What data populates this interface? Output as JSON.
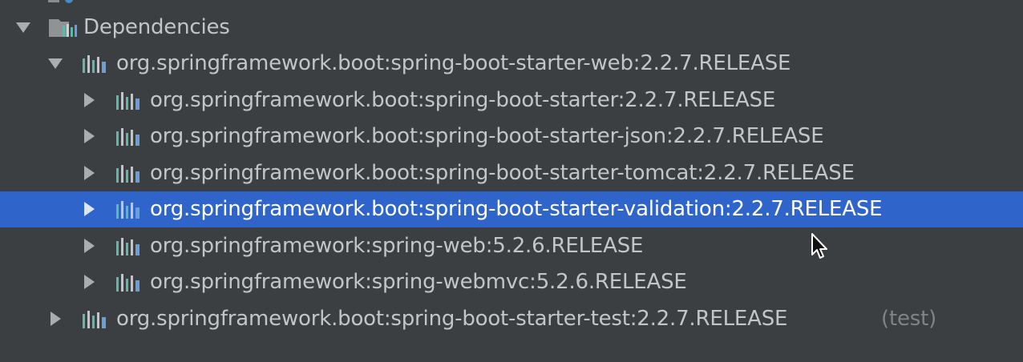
{
  "tree": {
    "root": {
      "label": "Dependencies",
      "icon": "library-folder-icon",
      "expanded": true
    },
    "items": [
      {
        "label": "org.springframework.boot:spring-boot-starter-web:2.2.7.RELEASE",
        "suffix": "",
        "expanded": true,
        "selected": false
      },
      {
        "label": "org.springframework.boot:spring-boot-starter:2.2.7.RELEASE",
        "suffix": "",
        "expanded": false,
        "selected": false
      },
      {
        "label": "org.springframework.boot:spring-boot-starter-json:2.2.7.RELEASE",
        "suffix": "",
        "expanded": false,
        "selected": false
      },
      {
        "label": "org.springframework.boot:spring-boot-starter-tomcat:2.2.7.RELEASE",
        "suffix": "",
        "expanded": false,
        "selected": false
      },
      {
        "label": "org.springframework.boot:spring-boot-starter-validation:2.2.7.RELEASE",
        "suffix": "",
        "expanded": false,
        "selected": true
      },
      {
        "label": "org.springframework:spring-web:5.2.6.RELEASE",
        "suffix": "",
        "expanded": false,
        "selected": false
      },
      {
        "label": "org.springframework:spring-webmvc:5.2.6.RELEASE",
        "suffix": "",
        "expanded": false,
        "selected": false
      },
      {
        "label": "org.springframework.boot:spring-boot-starter-test:2.2.7.RELEASE",
        "suffix": "(test)",
        "expanded": false,
        "selected": false
      }
    ]
  },
  "colors": {
    "background": "#3c3f41",
    "selection": "#2f65ca",
    "text": "#c2c6c9",
    "muted_suffix": "#808487",
    "library_icon_bars": [
      "#5fb8a8",
      "#c2c6c9",
      "#5fb8a8",
      "#c2c6c9",
      "#6a9fd8"
    ]
  }
}
